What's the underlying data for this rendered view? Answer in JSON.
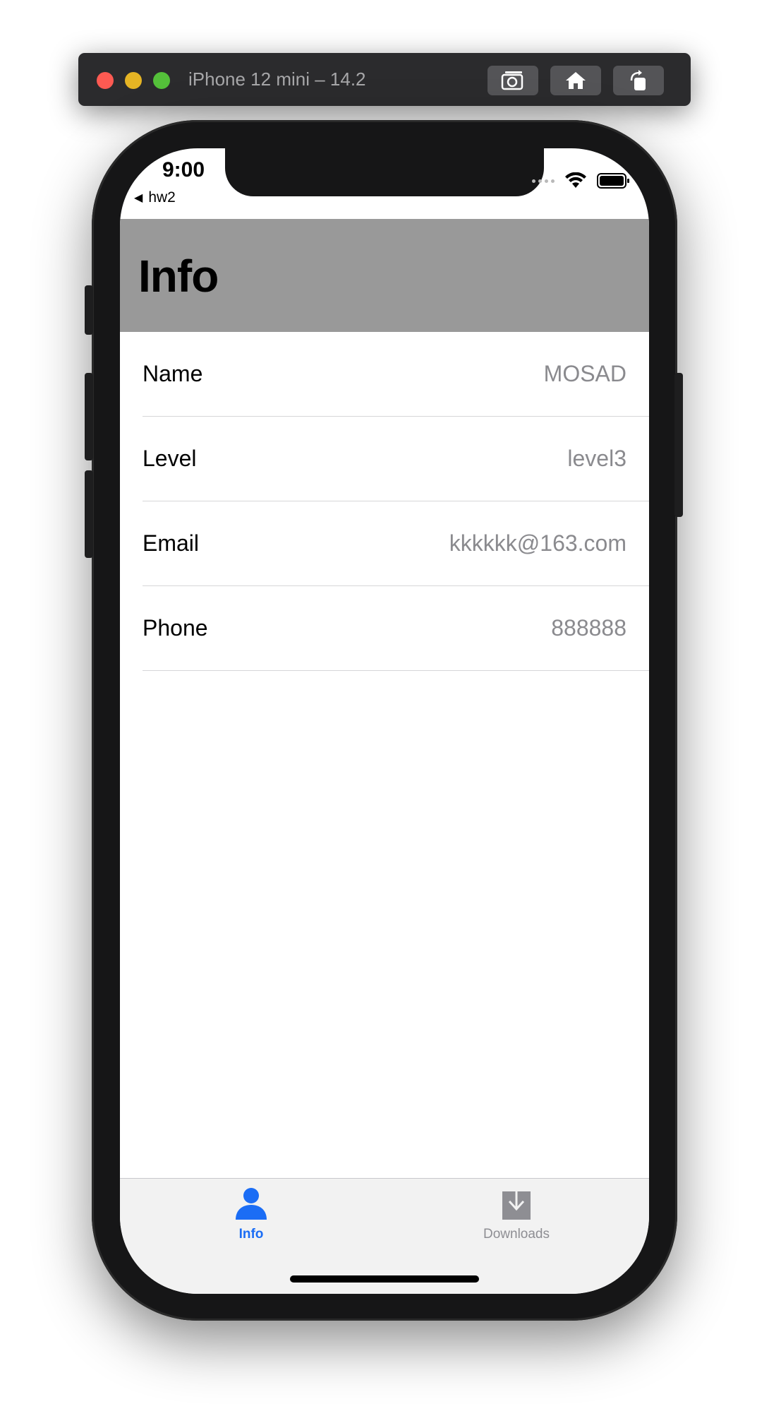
{
  "window": {
    "title": "iPhone 12 mini – 14.2",
    "buttons": [
      "screenshot-icon",
      "home-icon",
      "rotate-icon"
    ]
  },
  "status_bar": {
    "time": "9:00",
    "back_app": "hw2"
  },
  "nav": {
    "title": "Info"
  },
  "info_rows": [
    {
      "label": "Name",
      "value": "MOSAD"
    },
    {
      "label": "Level",
      "value": "level3"
    },
    {
      "label": "Email",
      "value": "kkkkkk@163.com"
    },
    {
      "label": "Phone",
      "value": "888888"
    }
  ],
  "tabs": [
    {
      "label": "Info",
      "icon": "person-icon",
      "selected": true
    },
    {
      "label": "Downloads",
      "icon": "download-icon",
      "selected": false
    }
  ],
  "colors": {
    "nav_background": "#999999",
    "tab_selected": "#1b6df5",
    "tab_unselected": "#8e8e93"
  }
}
